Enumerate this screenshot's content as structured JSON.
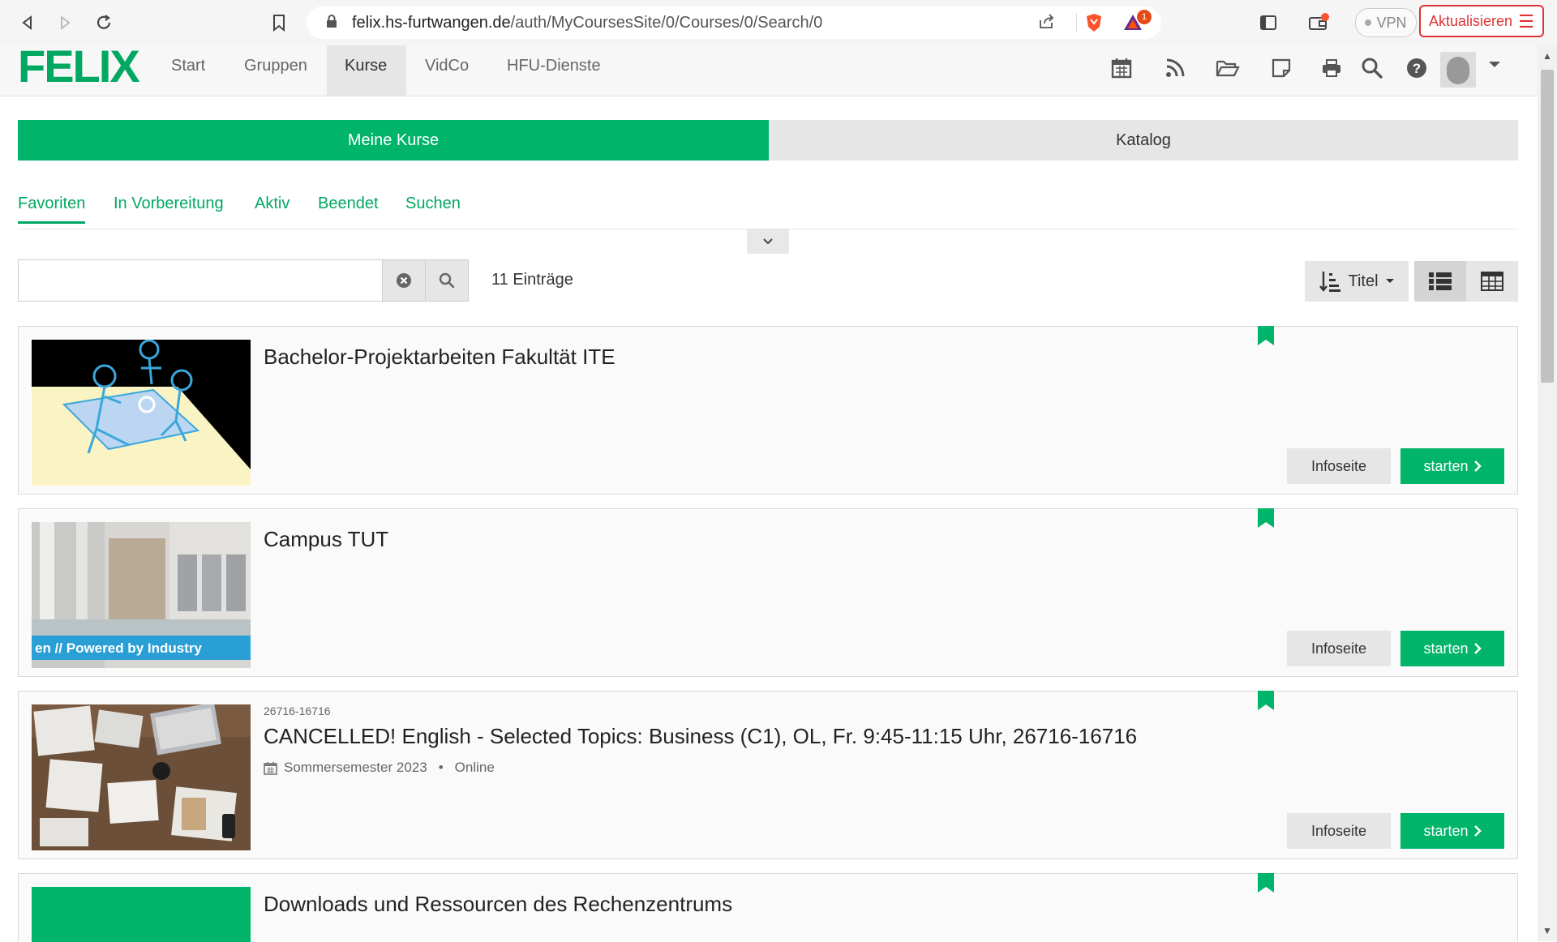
{
  "browser": {
    "url_host": "felix.hs-furtwangen.de",
    "url_path": "/auth/MyCoursesSite/0/Courses/0/Search/0",
    "vpn_label": "VPN",
    "update_label": "Aktualisieren",
    "notification_count": "1"
  },
  "header": {
    "logo": "FELIX",
    "nav": [
      "Start",
      "Gruppen",
      "Kurse",
      "VidCo",
      "HFU-Dienste"
    ],
    "active_nav": "Kurse",
    "icons": [
      "calendar-icon",
      "rss-icon",
      "folder-icon",
      "note-icon",
      "print-icon",
      "search-icon",
      "help-icon"
    ]
  },
  "main_tabs": {
    "my_courses": "Meine Kurse",
    "catalog": "Katalog"
  },
  "sub_tabs": [
    "Favoriten",
    "In Vorbereitung",
    "Aktiv",
    "Beendet",
    "Suchen"
  ],
  "search": {
    "value": "",
    "placeholder": "",
    "entries_count": "11 Einträge",
    "sort_label": "Titel"
  },
  "courses": [
    {
      "title": "Bachelor-Projektarbeiten Fakultät ITE",
      "info_label": "Infoseite",
      "start_label": "starten"
    },
    {
      "title": "Campus TUT",
      "thumb_banner": "en // Powered by Industry",
      "info_label": "Infoseite",
      "start_label": "starten"
    },
    {
      "id": "26716-16716",
      "title": "CANCELLED! English - Selected Topics: Business (C1), OL, Fr. 9:45-11:15 Uhr, 26716-16716",
      "semester": "Sommersemester 2023",
      "bullet": "•",
      "mode": "Online",
      "info_label": "Infoseite",
      "start_label": "starten"
    },
    {
      "title": "Downloads und Ressourcen des Rechenzentrums"
    }
  ],
  "colors": {
    "accent": "#00b46a",
    "logo": "#00a862"
  }
}
